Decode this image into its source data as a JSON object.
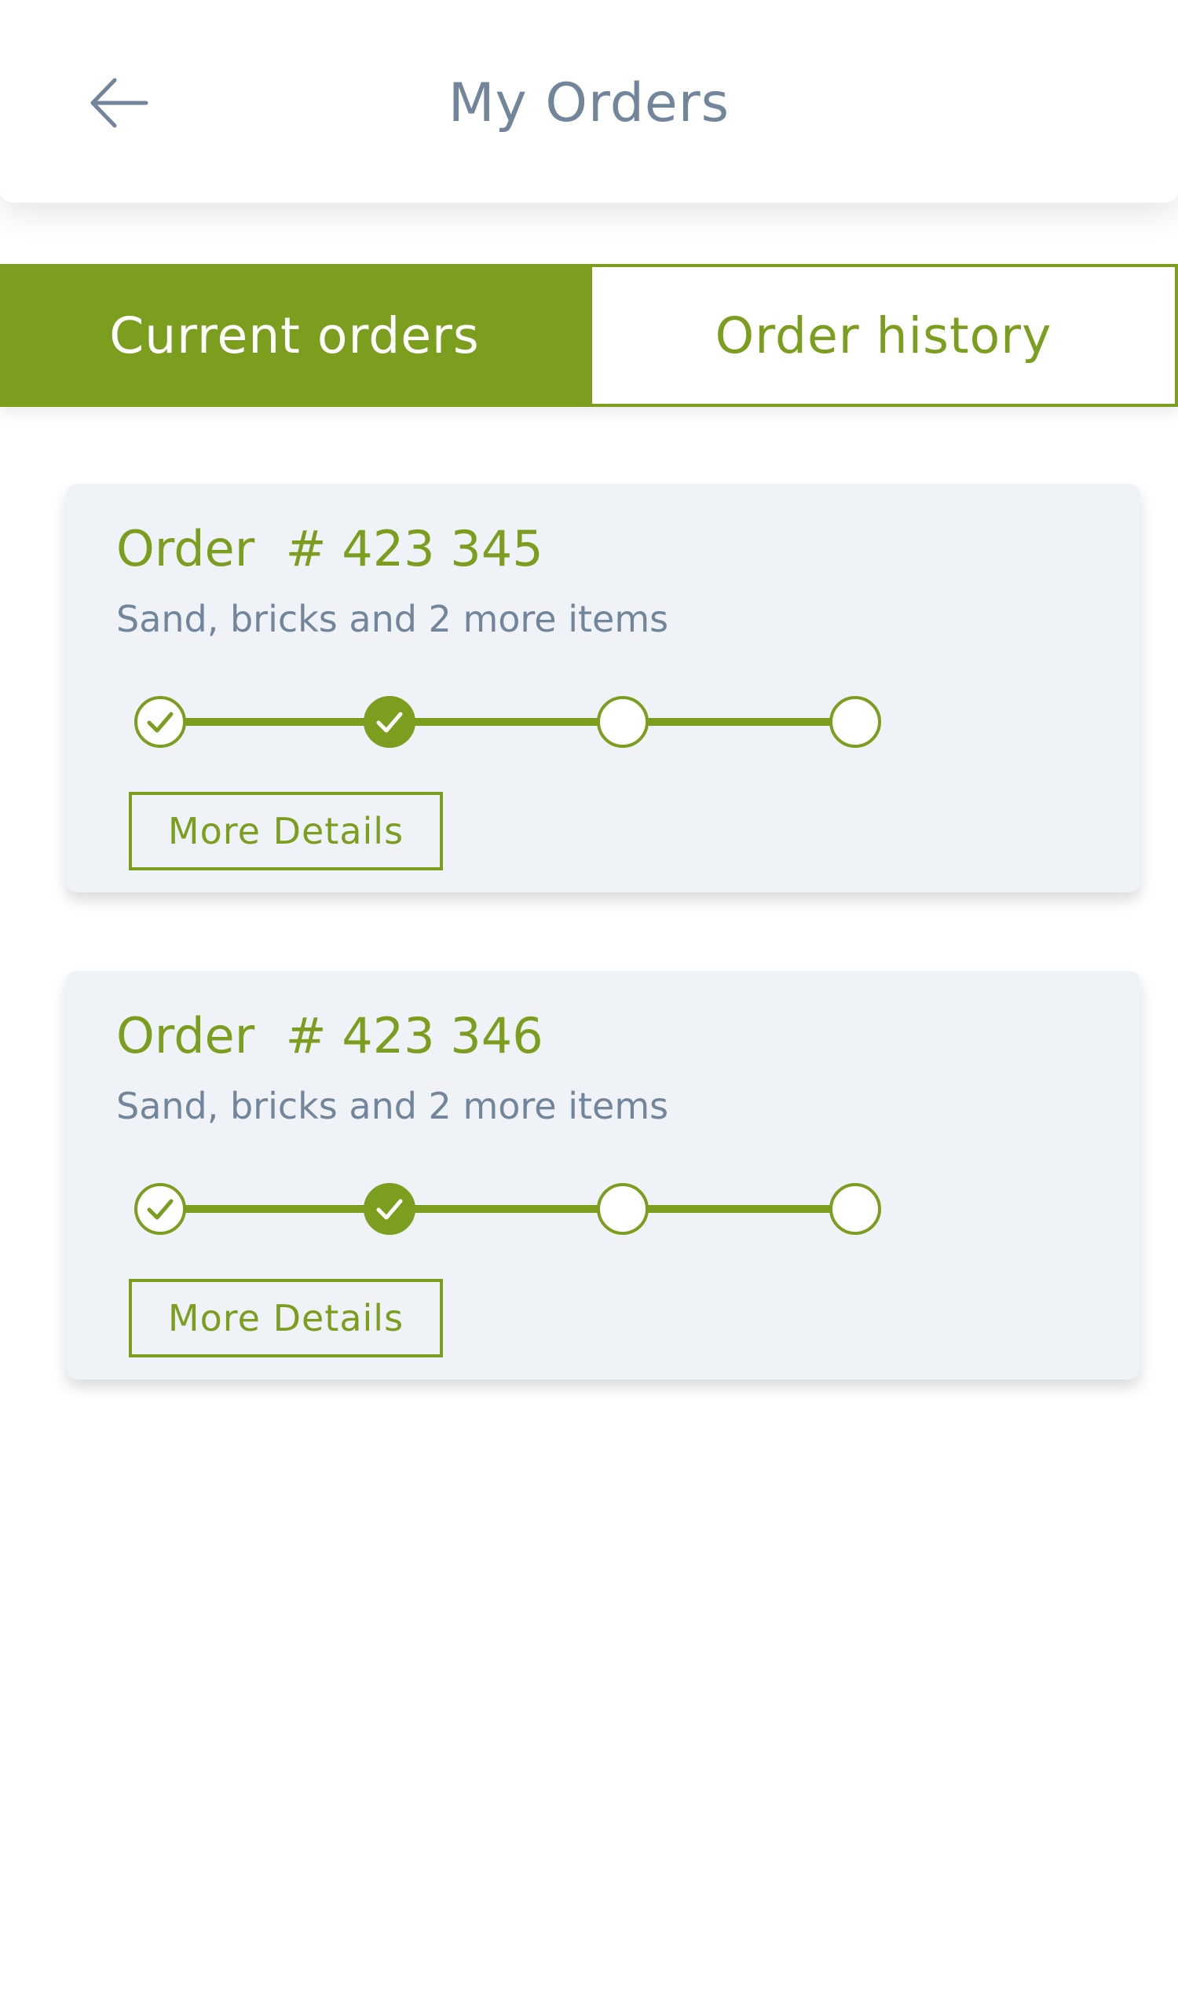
{
  "header": {
    "title": "My Orders",
    "back_icon": "arrow-left-icon"
  },
  "tabs": [
    {
      "label": "Current orders",
      "active": true
    },
    {
      "label": "Order history",
      "active": false
    }
  ],
  "orders": [
    {
      "title": "Order  # 423 345",
      "items": "Sand, bricks and 2 more items",
      "steps": [
        "complete",
        "current",
        "pending",
        "pending"
      ],
      "button_label": "More Details"
    },
    {
      "title": "Order  # 423 346",
      "items": "Sand, bricks and 2 more items",
      "steps": [
        "complete",
        "current",
        "pending",
        "pending"
      ],
      "button_label": "More Details"
    }
  ],
  "colors": {
    "accent": "#7b9e1f",
    "muted_text": "#71859b",
    "card_background": "#eff2f7"
  }
}
